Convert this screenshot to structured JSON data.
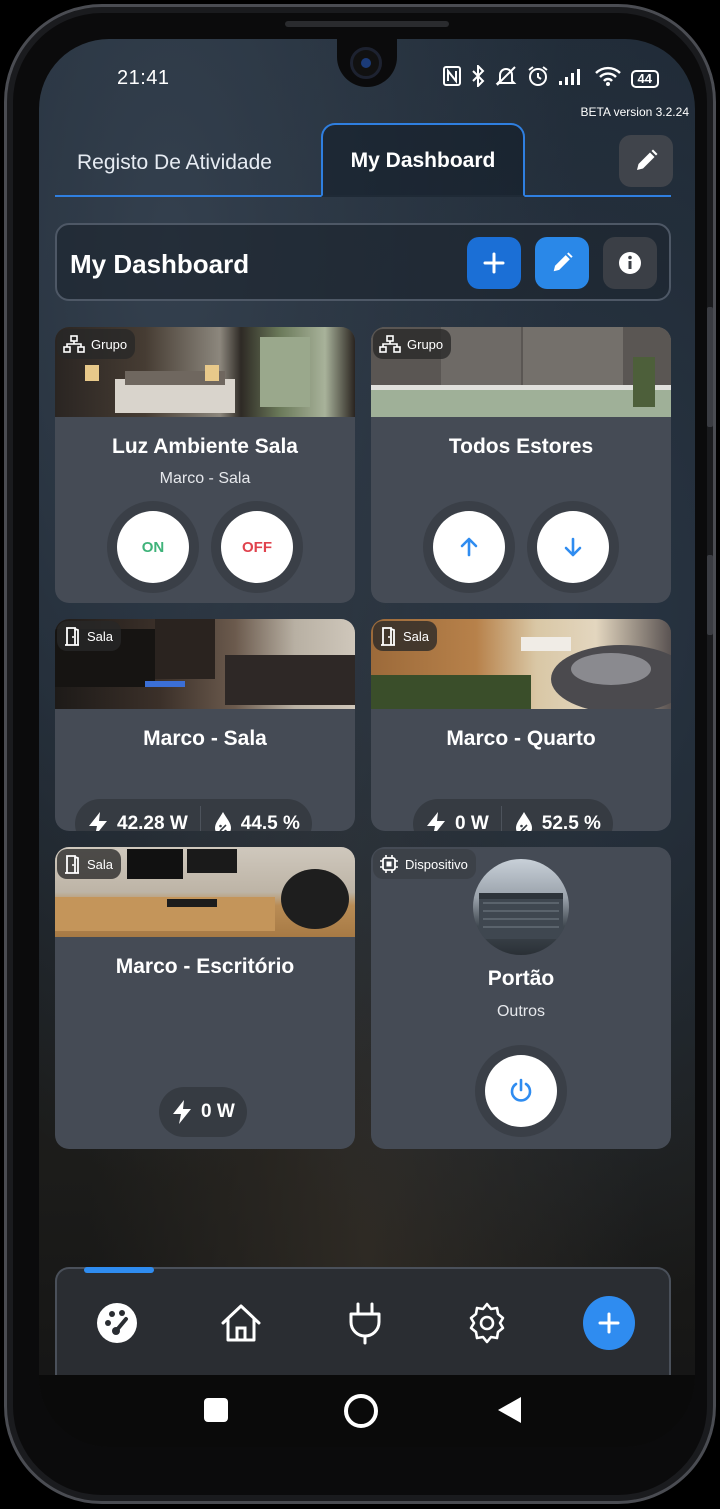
{
  "status": {
    "time": "21:41",
    "battery": "44"
  },
  "beta_label": "BETA version 3.2.24",
  "tabs": [
    {
      "label": "Registo De Atividade"
    },
    {
      "label": "My Dashboard"
    }
  ],
  "header": {
    "title": "My Dashboard"
  },
  "cards": [
    {
      "badge": "Grupo",
      "title": "Luz Ambiente Sala",
      "subtitle": "Marco - Sala",
      "btn_on": "ON",
      "btn_off": "OFF"
    },
    {
      "badge": "Grupo",
      "title": "Todos Estores"
    },
    {
      "badge": "Sala",
      "title": "Marco - Sala",
      "power": "42.28 W",
      "humidity": "44.5 %"
    },
    {
      "badge": "Sala",
      "title": "Marco - Quarto",
      "power": "0 W",
      "humidity": "52.5 %"
    },
    {
      "badge": "Sala",
      "title": "Marco - Escritório",
      "power": "0 W"
    },
    {
      "badge": "Dispositivo",
      "title": "Portão",
      "subtitle": "Outros"
    }
  ],
  "icons": {
    "group": "group-icon",
    "room": "door-icon",
    "device": "chip-icon",
    "power": "bolt-icon",
    "humidity": "drop-icon"
  },
  "nav": [
    "dashboard-icon",
    "home-icon",
    "plug-icon",
    "gear-icon",
    "plus-icon"
  ],
  "colors": {
    "accent": "#2f8cf0",
    "on": "#3fb37a",
    "off": "#e0424d"
  }
}
